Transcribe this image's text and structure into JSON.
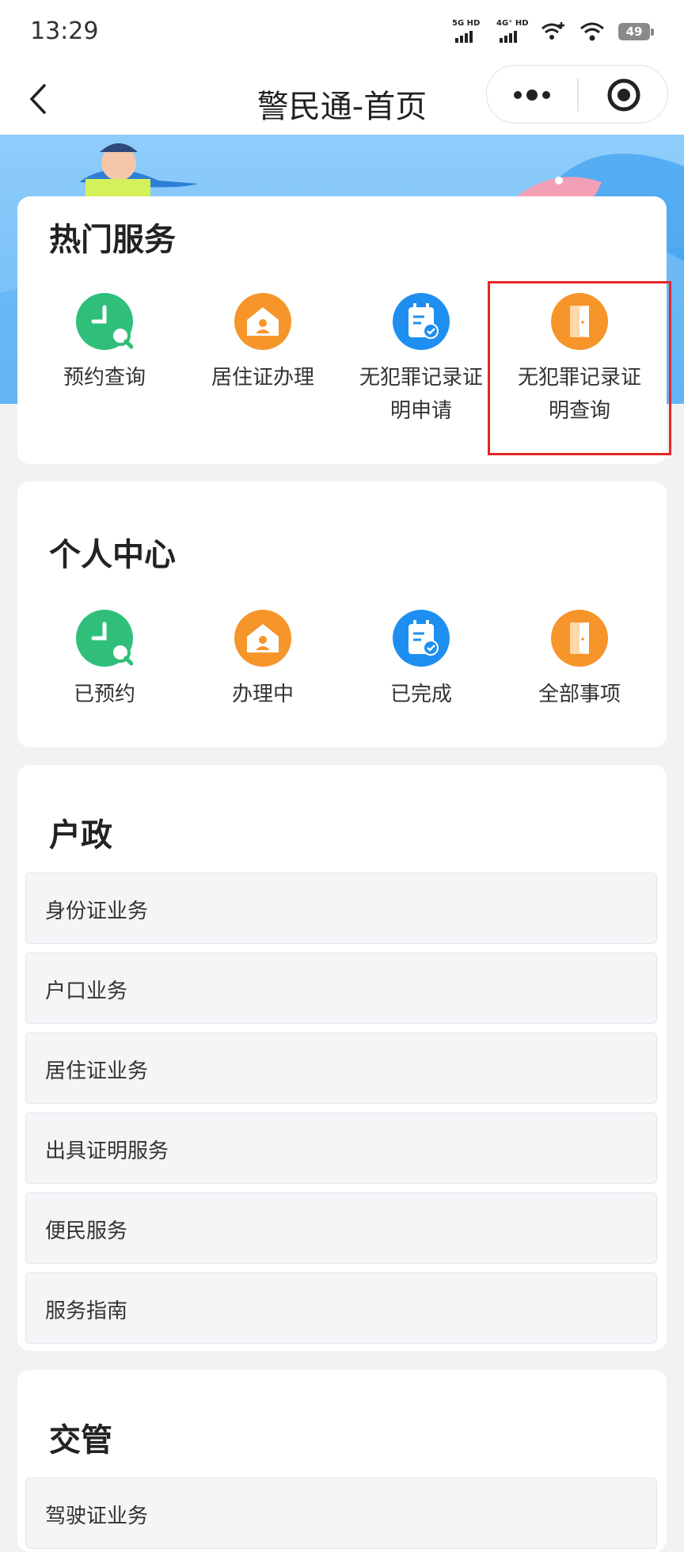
{
  "status_bar": {
    "time": "13:29",
    "network_1": "5G HD",
    "network_2": "4G⁺ HD",
    "battery": "49"
  },
  "nav": {
    "title": "警民通-首页"
  },
  "hot_services": {
    "title": "热门服务",
    "items": [
      {
        "label": "预约查询",
        "icon": "clock-search-icon",
        "color": "#2fbf7b"
      },
      {
        "label": "居住证办理",
        "icon": "house-user-icon",
        "color": "#f6952a"
      },
      {
        "label": "无犯罪记录证明申请",
        "icon": "calendar-check-icon",
        "color": "#1e8ff0"
      },
      {
        "label": "无犯罪记录证明查询",
        "icon": "door-icon",
        "color": "#f6952a"
      }
    ]
  },
  "personal_center": {
    "title": "个人中心",
    "items": [
      {
        "label": "已预约",
        "icon": "clock-search-icon",
        "color": "#2fbf7b"
      },
      {
        "label": "办理中",
        "icon": "house-user-icon",
        "color": "#f6952a"
      },
      {
        "label": "已完成",
        "icon": "calendar-check-icon",
        "color": "#1e8ff0"
      },
      {
        "label": "全部事项",
        "icon": "door-icon",
        "color": "#f6952a"
      }
    ]
  },
  "household": {
    "title": "户政",
    "items": [
      "身份证业务",
      "户口业务",
      "居住证业务",
      "出具证明服务",
      "便民服务",
      "服务指南"
    ]
  },
  "traffic": {
    "title": "交管",
    "items": [
      "驾驶证业务"
    ]
  }
}
